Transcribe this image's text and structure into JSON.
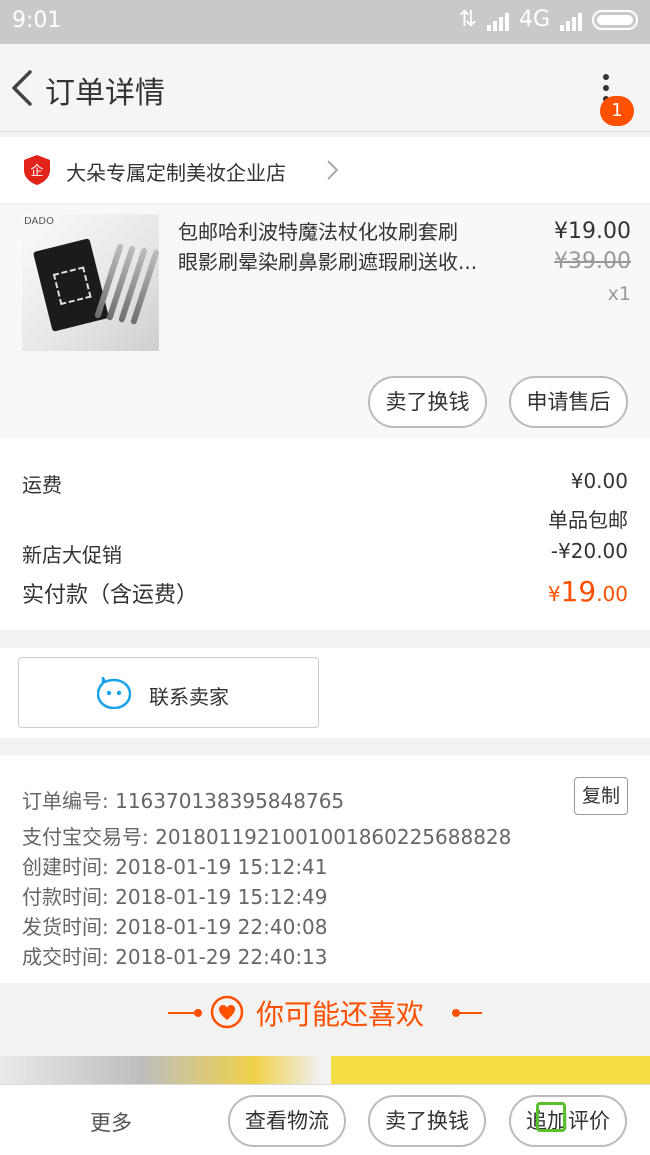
{
  "status_bar": {
    "time": "9:01",
    "network": "4G"
  },
  "header": {
    "title": "订单详情",
    "badge_count": "1"
  },
  "shop": {
    "name": "大朵专属定制美妆企业店"
  },
  "product": {
    "title_line1": "包邮哈利波特魔法杖化妆刷套刷",
    "title_line2": "眼影刷晕染刷鼻影刷遮瑕刷送收...",
    "price": "¥19.00",
    "original_price": "¥39.00",
    "quantity": "x1",
    "thumb_logo": "DADO",
    "btn_sell": "卖了换钱",
    "btn_after_sale": "申请售后"
  },
  "fees": {
    "shipping_label": "运费",
    "shipping_value": "¥0.00",
    "shipping_note": "单品包邮",
    "promo_label": "新店大促销",
    "promo_value": "-¥20.00",
    "total_label": "实付款（含运费）",
    "total_currency": "¥",
    "total_int": "19",
    "total_dec": ".00"
  },
  "contact": {
    "label": "联系卖家"
  },
  "order_info": {
    "order_no": "订单编号: 116370138395848765",
    "copy_label": "复制",
    "alipay_no": "支付宝交易号: 2018011921001001860225688828",
    "created": "创建时间: 2018-01-19 15:12:41",
    "paid": "付款时间: 2018-01-19 15:12:49",
    "shipped": "发货时间: 2018-01-19 22:40:08",
    "completed": "成交时间: 2018-01-29 22:40:13"
  },
  "recommend": {
    "title": "你可能还喜欢"
  },
  "bottom_bar": {
    "more": "更多",
    "logistics": "查看物流",
    "sell": "卖了换钱",
    "review": "追加评价"
  },
  "colors": {
    "accent": "#ff5000",
    "icon_blue": "#1aa3e8"
  }
}
